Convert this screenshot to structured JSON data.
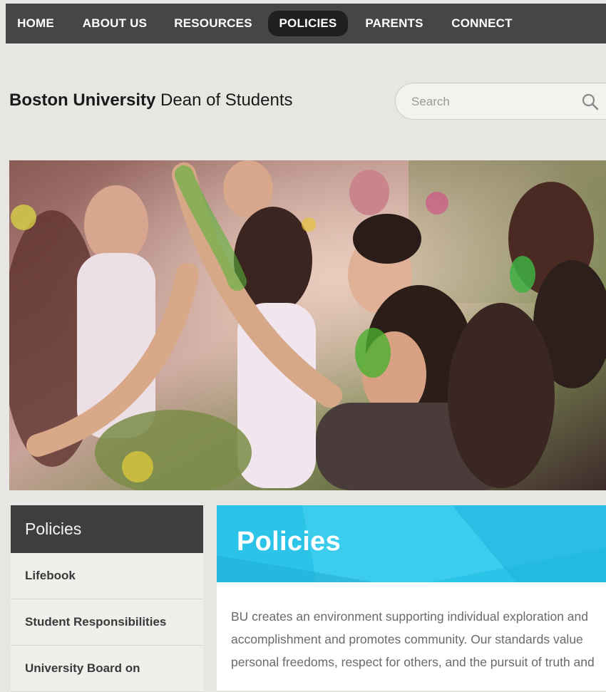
{
  "nav": {
    "items": [
      "HOME",
      "ABOUT US",
      "RESOURCES",
      "POLICIES",
      "PARENTS",
      "CONNECT"
    ],
    "active": "POLICIES"
  },
  "brand": {
    "university": "Boston University",
    "office": "Dean of Students"
  },
  "search": {
    "placeholder": "Search",
    "icon": "search-icon"
  },
  "sidebar": {
    "title": "Policies",
    "items": [
      "Lifebook",
      "Student Responsibilities",
      "University Board on"
    ]
  },
  "main": {
    "title": "Policies",
    "intro": "BU creates an environment supporting individual exploration and accomplishment and promotes community. Our standards value personal freedoms, respect for others, and the pursuit of truth and"
  },
  "colors": {
    "nav_bg": "#464646",
    "nav_active": "#1f1f1f",
    "banner": "#2bc4e8",
    "sidebar_head": "#3e3e3e"
  }
}
